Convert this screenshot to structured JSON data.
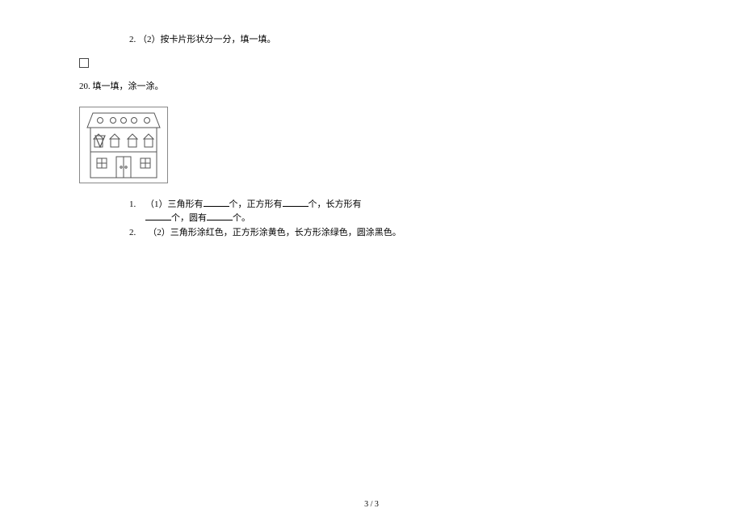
{
  "item2": {
    "num": "2.",
    "text": "（2）按卡片形状分一分，填一填。"
  },
  "q20": {
    "num": "20.",
    "text": "填一填，涂一涂。"
  },
  "sub": {
    "n1": "1.",
    "t1a": "（1）三角形有",
    "t1b": "个，正方形有",
    "t1c": "个，长方形有",
    "t1d": "个，圆有",
    "t1e": "个。",
    "n2": "2.",
    "t2": "（2）三角形涂红色，正方形涂黄色，长方形涂绿色，圆涂黑色。"
  },
  "pagenum": "3 / 3"
}
